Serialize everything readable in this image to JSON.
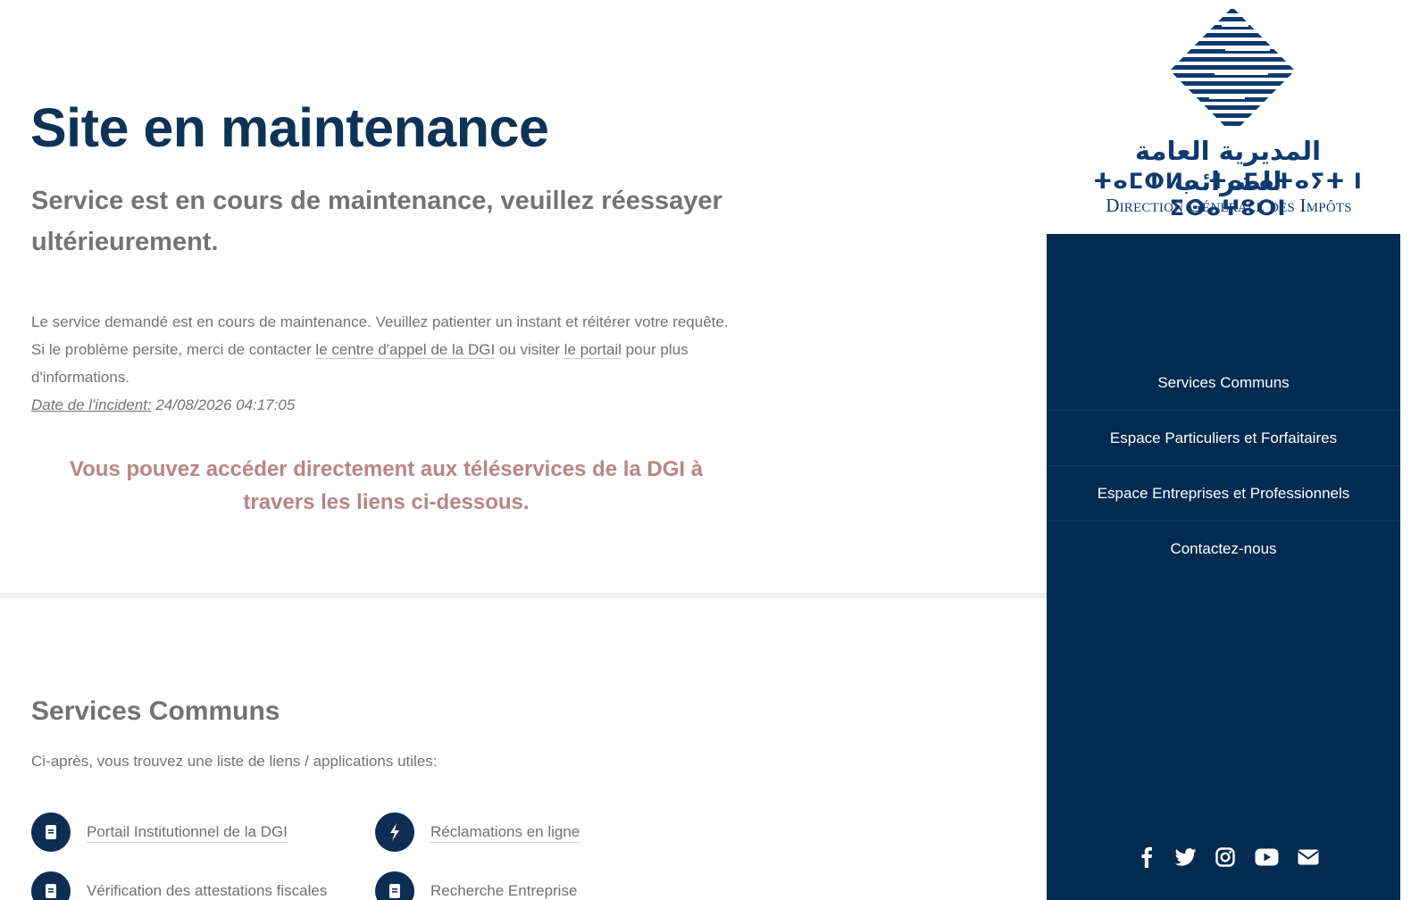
{
  "main": {
    "title": "Site en maintenance",
    "subtitle": "Service est en cours de maintenance, veuillez réessayer ultérieurement.",
    "info": {
      "line1": "Le service demandé est en cours de maintenance. Veuillez patienter un instant et réitérer votre requête.",
      "line2_prefix": "Si le problème persite, merci de contacter ",
      "call_center_link": "le centre d'appel de la DGI",
      "line2_mid": " ou visiter ",
      "portal_link": "le portail",
      "line2_suffix": " pour plus d'informations.",
      "incident_label": "Date de l'incident:",
      "incident_value": " 24/08/2026 04:17:05"
    },
    "highlight": "Vous pouvez accéder directement aux téléservices de la DGI à travers les liens ci-dessous.",
    "section": {
      "title": "Services Communs",
      "intro": "Ci-après, vous trouvez une liste de liens / applications utiles:",
      "links": [
        {
          "label": "Portail Institutionnel de la DGI",
          "icon": "book-icon"
        },
        {
          "label": "Réclamations en ligne",
          "icon": "bolt-icon"
        },
        {
          "label": "Vérification des attestations fiscales",
          "icon": "book-icon"
        },
        {
          "label": "Recherche Entreprise",
          "icon": "book-icon"
        }
      ]
    }
  },
  "logo": {
    "arabic": "المديرية العامة للضرائب",
    "tifinagh": "ⵜⴰⵎⵀⵍⴰ ⵜⴰⵎⴰⵜⴰⵢⵜ ⵏ ⵉⵙⴰⵖⵓⵔⵏ",
    "name": "Direction Générale des Impôts",
    "color": "#0f3a70"
  },
  "sidebar": {
    "background": "#032a51",
    "nav": [
      {
        "label": "Services Communs"
      },
      {
        "label": "Espace Particuliers et Forfaitaires"
      },
      {
        "label": "Espace Entreprises et Professionnels"
      },
      {
        "label": "Contactez-nous"
      }
    ],
    "social": [
      "facebook-icon",
      "twitter-icon",
      "instagram-icon",
      "youtube-icon",
      "email-icon"
    ]
  },
  "colors": {
    "title": "#0f3356",
    "highlight": "#b88585",
    "icon_circle": "#0d2e52"
  }
}
